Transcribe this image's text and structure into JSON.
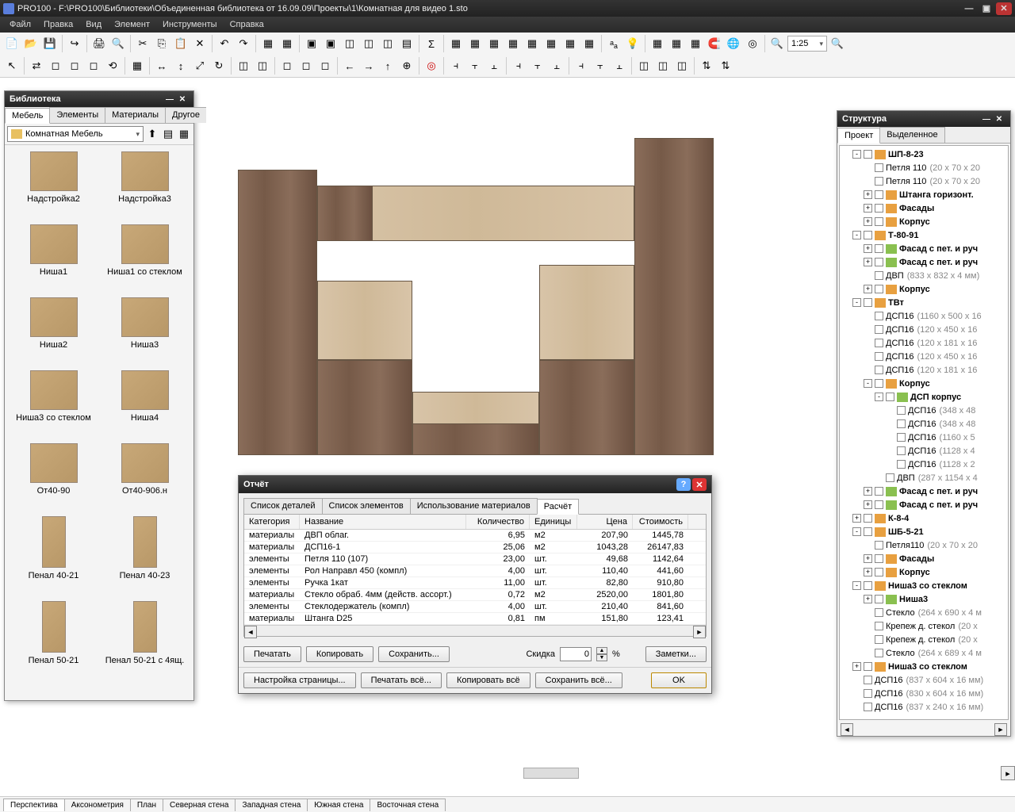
{
  "title": "PRO100 - F:\\PRO100\\Библиотеки\\Объединенная библиотека от 16.09.09\\Проекты\\1\\Комнатная для видео 1.sto",
  "menu": [
    "Файл",
    "Правка",
    "Вид",
    "Элемент",
    "Инструменты",
    "Справка"
  ],
  "zoom": "1:25",
  "library": {
    "title": "Библиотека",
    "tabs": [
      "Мебель",
      "Элементы",
      "Материалы",
      "Другое"
    ],
    "combo": "Комнатная Мебель",
    "items": [
      {
        "label": "Надстройка2"
      },
      {
        "label": "Надстройка3"
      },
      {
        "label": "Ниша1"
      },
      {
        "label": "Ниша1 со стеклом"
      },
      {
        "label": "Ниша2"
      },
      {
        "label": "Ниша3"
      },
      {
        "label": "Ниша3 со стеклом"
      },
      {
        "label": "Ниша4"
      },
      {
        "label": "От40-90"
      },
      {
        "label": "От40-906.н"
      },
      {
        "label": "Пенал 40-21",
        "tall": true
      },
      {
        "label": "Пенал 40-23",
        "tall": true
      },
      {
        "label": "Пенал 50-21",
        "tall": true
      },
      {
        "label": "Пенал 50-21 с 4ящ.",
        "tall": true
      }
    ]
  },
  "structure": {
    "title": "Структура",
    "tabs": [
      "Проект",
      "Выделенное"
    ],
    "nodes": [
      {
        "d": 1,
        "exp": "-",
        "bold": true,
        "ico": "grp",
        "lbl": "ШП-8-23"
      },
      {
        "d": 2,
        "lbl": "Петля 110",
        "dim": "(20 x 70 x 20"
      },
      {
        "d": 2,
        "lbl": "Петля 110",
        "dim": "(20 x 70 x 20"
      },
      {
        "d": 2,
        "exp": "+",
        "bold": true,
        "ico": "grp",
        "lbl": "Штанга горизонт."
      },
      {
        "d": 2,
        "exp": "+",
        "bold": true,
        "ico": "grp",
        "lbl": "Фасады"
      },
      {
        "d": 2,
        "exp": "+",
        "bold": true,
        "ico": "grp",
        "lbl": "Корпус"
      },
      {
        "d": 1,
        "exp": "-",
        "bold": true,
        "ico": "grp",
        "lbl": "Т-80-91"
      },
      {
        "d": 2,
        "exp": "+",
        "bold": true,
        "ico": "itm",
        "lbl": "Фасад с пет. и руч"
      },
      {
        "d": 2,
        "exp": "+",
        "bold": true,
        "ico": "itm",
        "lbl": "Фасад с пет. и руч"
      },
      {
        "d": 2,
        "lbl": "ДВП",
        "dim": "(833 x 832 x 4 мм)"
      },
      {
        "d": 2,
        "exp": "+",
        "bold": true,
        "ico": "grp",
        "lbl": "Корпус"
      },
      {
        "d": 1,
        "exp": "-",
        "bold": true,
        "ico": "grp",
        "lbl": "ТВт"
      },
      {
        "d": 2,
        "lbl": "ДСП16",
        "dim": "(1160 x 500 x 16"
      },
      {
        "d": 2,
        "lbl": "ДСП16",
        "dim": "(120 x 450 x 16"
      },
      {
        "d": 2,
        "lbl": "ДСП16",
        "dim": "(120 x 181 x 16"
      },
      {
        "d": 2,
        "lbl": "ДСП16",
        "dim": "(120 x 450 x 16"
      },
      {
        "d": 2,
        "lbl": "ДСП16",
        "dim": "(120 x 181 x 16"
      },
      {
        "d": 2,
        "exp": "-",
        "bold": true,
        "ico": "grp",
        "lbl": "Корпус"
      },
      {
        "d": 3,
        "exp": "-",
        "bold": true,
        "ico": "itm",
        "lbl": "ДСП корпус"
      },
      {
        "d": 4,
        "lbl": "ДСП16",
        "dim": "(348 x 48"
      },
      {
        "d": 4,
        "lbl": "ДСП16",
        "dim": "(348 x 48"
      },
      {
        "d": 4,
        "lbl": "ДСП16",
        "dim": "(1160 x 5"
      },
      {
        "d": 4,
        "lbl": "ДСП16",
        "dim": "(1128 x 4"
      },
      {
        "d": 4,
        "lbl": "ДСП16",
        "dim": "(1128 x 2"
      },
      {
        "d": 3,
        "lbl": "ДВП",
        "dim": "(287 x 1154 x 4"
      },
      {
        "d": 2,
        "exp": "+",
        "bold": true,
        "ico": "itm",
        "lbl": "Фасад с пет. и руч"
      },
      {
        "d": 2,
        "exp": "+",
        "bold": true,
        "ico": "itm",
        "lbl": "Фасад с пет. и руч"
      },
      {
        "d": 1,
        "exp": "+",
        "bold": true,
        "ico": "grp",
        "lbl": "К-8-4"
      },
      {
        "d": 1,
        "exp": "-",
        "bold": true,
        "ico": "grp",
        "lbl": "ШБ-5-21"
      },
      {
        "d": 2,
        "lbl": "Петля110",
        "dim": "(20 x 70 x 20"
      },
      {
        "d": 2,
        "exp": "+",
        "bold": true,
        "ico": "grp",
        "lbl": "Фасады"
      },
      {
        "d": 2,
        "exp": "+",
        "bold": true,
        "ico": "grp",
        "lbl": "Корпус"
      },
      {
        "d": 1,
        "exp": "-",
        "bold": true,
        "ico": "grp",
        "lbl": "Ниша3 со стеклом"
      },
      {
        "d": 2,
        "exp": "+",
        "bold": true,
        "ico": "itm",
        "lbl": "Ниша3"
      },
      {
        "d": 2,
        "lbl": "Стекло",
        "dim": "(264 x 690 x 4 м"
      },
      {
        "d": 2,
        "lbl": "Крепеж д. стекол",
        "dim": "(20 х"
      },
      {
        "d": 2,
        "lbl": "Крепеж д. стекол",
        "dim": "(20 х"
      },
      {
        "d": 2,
        "lbl": "Стекло",
        "dim": "(264 x 689 x 4 м"
      },
      {
        "d": 1,
        "exp": "+",
        "bold": true,
        "ico": "grp",
        "lbl": "Ниша3 со стеклом"
      },
      {
        "d": 1,
        "lbl": "ДСП16",
        "dim": "(837 x 604 x 16 мм)"
      },
      {
        "d": 1,
        "lbl": "ДСП16",
        "dim": "(830 x 604 x 16 мм)"
      },
      {
        "d": 1,
        "lbl": "ДСП16",
        "dim": "(837 x 240 x 16 мм)"
      }
    ]
  },
  "report": {
    "title": "Отчёт",
    "tabs": [
      "Список деталей",
      "Список элементов",
      "Использование материалов",
      "Расчёт"
    ],
    "headers": [
      "Категория",
      "Название",
      "Количество",
      "Единицы",
      "Цена",
      "Стоимость"
    ],
    "rows": [
      [
        "материалы",
        "ДВП облаг.",
        "6,95",
        "м2",
        "207,90",
        "1445,78"
      ],
      [
        "материалы",
        "ДСП16-1",
        "25,06",
        "м2",
        "1043,28",
        "26147,83"
      ],
      [
        "элементы",
        "Петля 110 (107)",
        "23,00",
        "шт.",
        "49,68",
        "1142,64"
      ],
      [
        "элементы",
        "Рол Направл 450 (компл)",
        "4,00",
        "шт.",
        "110,40",
        "441,60"
      ],
      [
        "элементы",
        "Ручка 1кат",
        "11,00",
        "шт.",
        "82,80",
        "910,80"
      ],
      [
        "материалы",
        "Стекло обраб. 4мм (действ. ассорт.)",
        "0,72",
        "м2",
        "2520,00",
        "1801,80"
      ],
      [
        "элементы",
        "Стеклодержатель (компл)",
        "4,00",
        "шт.",
        "210,40",
        "841,60"
      ],
      [
        "материалы",
        "Штанга D25",
        "0,81",
        "пм",
        "151,80",
        "123,41"
      ]
    ],
    "btns1": {
      "print": "Печатать",
      "copy": "Копировать",
      "save": "Сохранить...",
      "discount": "Скидка",
      "discount_val": "0",
      "notes": "Заметки..."
    },
    "btns2": {
      "page": "Настройка страницы...",
      "printall": "Печатать всё...",
      "copyall": "Копировать всё",
      "saveall": "Сохранить всё...",
      "ok": "OK"
    }
  },
  "viewtabs": [
    "Перспектива",
    "Аксонометрия",
    "План",
    "Северная стена",
    "Западная стена",
    "Южная стена",
    "Восточная стена"
  ]
}
